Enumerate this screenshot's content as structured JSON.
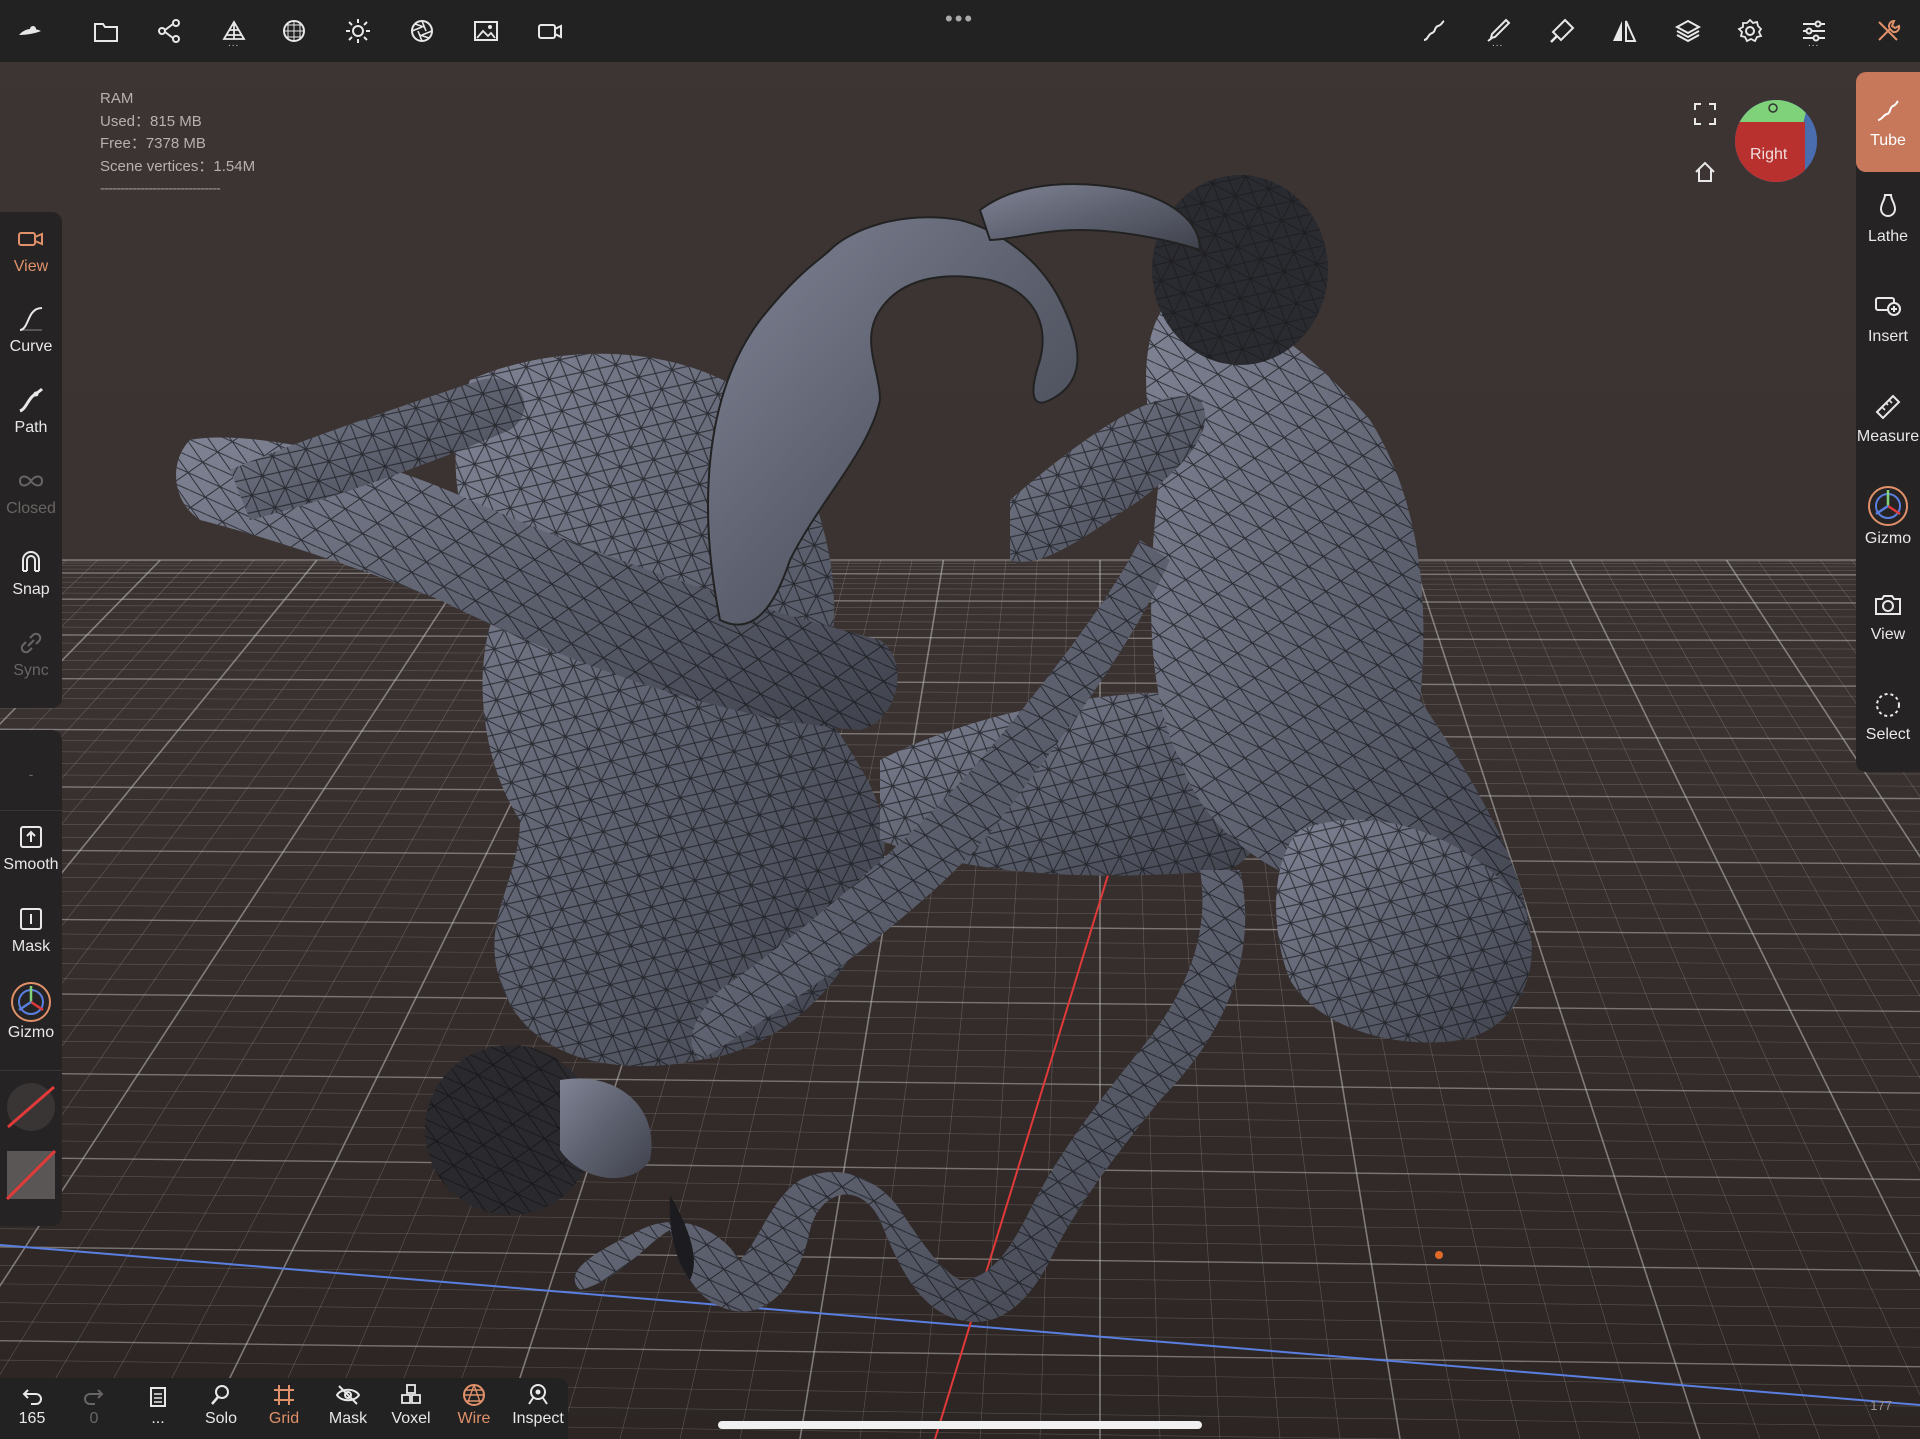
{
  "colors": {
    "accent": "#e0916a",
    "panel": "#252323",
    "bar": "#222222",
    "grid_line": "#bfbfbf",
    "x_axis": "#e03a3a",
    "z_axis": "#5a7fe0",
    "navcube_right": "#b8312f",
    "navcube_top": "#7fd17a",
    "navcube_side": "#4a6db0"
  },
  "topbar": {
    "left_icons": [
      "app-logo-icon",
      "folder-icon",
      "scene-tree-icon",
      "topology-icon",
      "sphere-grid-icon",
      "sun-icon",
      "aperture-icon",
      "image-icon",
      "camera-video-icon"
    ],
    "ellipsis": "•••",
    "right_icons": [
      "stroke-icon",
      "brush-icon",
      "paint-icon",
      "symmetry-icon",
      "layers-icon",
      "settings-icon",
      "sliders-icon",
      "tools-icon"
    ]
  },
  "ram_info": {
    "title": "RAM",
    "used": "Used：815 MB",
    "free": "Free：7378 MB",
    "vertices": "Scene vertices：1.54M",
    "divider": "------------------------------"
  },
  "left_panel_top": [
    {
      "label": "View",
      "icon": "camera-icon",
      "state": "active"
    },
    {
      "label": "Curve",
      "icon": "curve-icon",
      "state": "normal"
    },
    {
      "label": "Path",
      "icon": "path-icon",
      "state": "normal"
    },
    {
      "label": "Closed",
      "icon": "infinity-icon",
      "state": "disabled"
    },
    {
      "label": "Snap",
      "icon": "magnet-icon",
      "state": "normal"
    },
    {
      "label": "Sync",
      "icon": "link-icon",
      "state": "disabled"
    }
  ],
  "left_panel_bottom": {
    "top_marker": "-",
    "items": [
      {
        "label": "Smooth",
        "icon": "smooth-icon"
      },
      {
        "label": "Mask",
        "icon": "mask-square-icon"
      },
      {
        "label": "Gizmo",
        "icon": "gizmo-icon"
      }
    ]
  },
  "right_panel": [
    {
      "label": "Tube",
      "icon": "tube-icon",
      "state": "active"
    },
    {
      "label": "Lathe",
      "icon": "lathe-icon",
      "state": "normal"
    },
    {
      "label": "Insert",
      "icon": "insert-icon",
      "state": "normal"
    },
    {
      "label": "Measure",
      "icon": "ruler-icon",
      "state": "normal"
    },
    {
      "label": "Gizmo",
      "icon": "gizmo-icon",
      "state": "normal"
    },
    {
      "label": "View",
      "icon": "camera-icon",
      "state": "normal"
    },
    {
      "label": "Select",
      "icon": "select-circle-icon",
      "state": "normal"
    }
  ],
  "bottombar": [
    {
      "label": "165",
      "icon": "undo-icon",
      "state": "normal"
    },
    {
      "label": "0",
      "icon": "redo-icon",
      "state": "disabled"
    },
    {
      "label": "...",
      "icon": "document-icon",
      "state": "normal"
    },
    {
      "label": "Solo",
      "icon": "search-icon",
      "state": "normal"
    },
    {
      "label": "Grid",
      "icon": "grid-icon",
      "state": "active"
    },
    {
      "label": "Mask",
      "icon": "eye-off-icon",
      "state": "normal"
    },
    {
      "label": "Voxel",
      "icon": "voxel-icon",
      "state": "normal"
    },
    {
      "label": "Wire",
      "icon": "wire-icon",
      "state": "active"
    },
    {
      "label": "Inspect",
      "icon": "inspect-icon",
      "state": "normal"
    }
  ],
  "navcube": {
    "face_label": "Right"
  },
  "corner_number": "177"
}
